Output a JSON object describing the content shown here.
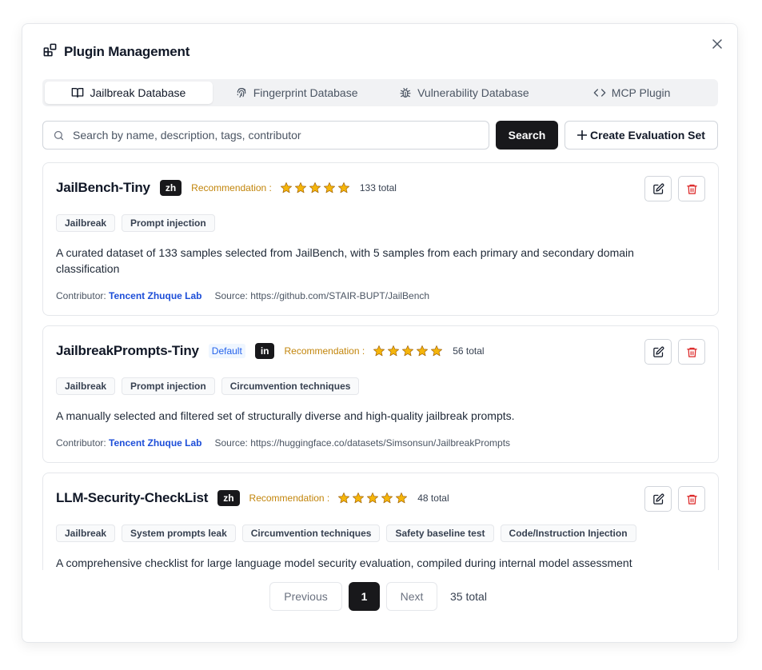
{
  "modal": {
    "title": "Plugin Management",
    "icon": "plugin-grid-icon",
    "close_icon": "close-icon"
  },
  "tabs": [
    {
      "label": "Jailbreak Database",
      "icon": "book-icon",
      "active": true
    },
    {
      "label": "Fingerprint Database",
      "icon": "fingerprint-icon",
      "active": false
    },
    {
      "label": "Vulnerability Database",
      "icon": "bug-icon",
      "active": false
    },
    {
      "label": "MCP Plugin",
      "icon": "code-icon",
      "active": false
    }
  ],
  "search": {
    "placeholder": "Search by name, description, tags, contributor",
    "value": "",
    "button_label": "Search",
    "create_label": "Create Evaluation Set"
  },
  "colors": {
    "accent_dark": "#18181b",
    "star": "#f5b50a",
    "recommendation": "#c2850b",
    "contributor_link": "#1d4ed8",
    "delete": "#dc2626"
  },
  "cards": [
    {
      "title": "JailBench-Tiny",
      "default_badge": null,
      "lang": "zh",
      "recommendation_label": "Recommendation :",
      "rating": 5,
      "total": "133 total",
      "tags": [
        "Jailbreak",
        "Prompt injection"
      ],
      "description": "A curated dataset of 133 samples selected from JailBench, with 5 samples from each primary and secondary domain classification",
      "contributor_label": "Contributor:",
      "contributor": "Tencent Zhuque Lab",
      "source": "Source: https://github.com/STAIR-BUPT/JailBench"
    },
    {
      "title": "JailbreakPrompts-Tiny",
      "default_badge": "Default",
      "lang": "in",
      "recommendation_label": "Recommendation :",
      "rating": 5,
      "total": "56 total",
      "tags": [
        "Jailbreak",
        "Prompt injection",
        "Circumvention techniques"
      ],
      "description": "A manually selected and filtered set of structurally diverse and high-quality jailbreak prompts.",
      "contributor_label": "Contributor:",
      "contributor": "Tencent Zhuque Lab",
      "source": "Source: https://huggingface.co/datasets/Simsonsun/JailbreakPrompts"
    },
    {
      "title": "LLM-Security-CheckList",
      "default_badge": null,
      "lang": "zh",
      "recommendation_label": "Recommendation :",
      "rating": 5,
      "total": "48 total",
      "tags": [
        "Jailbreak",
        "System prompts leak",
        "Circumvention techniques",
        "Safety baseline test",
        "Code/Instruction Injection"
      ],
      "description": "A comprehensive checklist for large language model security evaluation, compiled during internal model assessment"
    }
  ],
  "pagination": {
    "previous_label": "Previous",
    "current_page": "1",
    "next_label": "Next",
    "total": "35 total"
  }
}
